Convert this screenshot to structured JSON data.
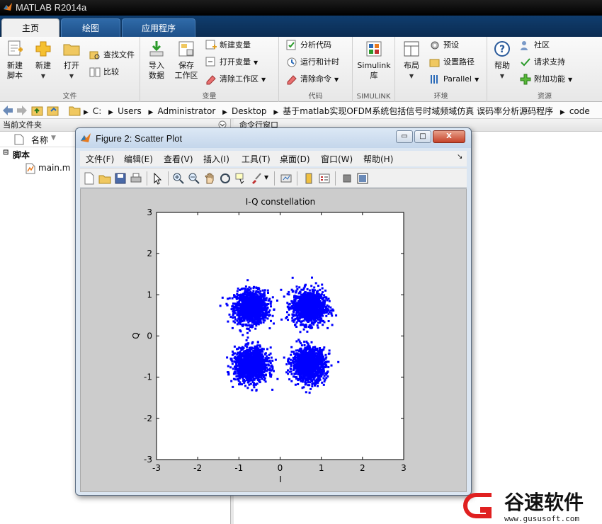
{
  "app": {
    "title": "MATLAB R2014a"
  },
  "tabs": [
    {
      "label": "主页",
      "active": true
    },
    {
      "label": "绘图",
      "active": false
    },
    {
      "label": "应用程序",
      "active": false
    }
  ],
  "ribbon": {
    "file": {
      "label": "文件",
      "new_script": "新建\n脚本",
      "new": "新建",
      "open": "打开",
      "find_files": "查找文件",
      "compare": "比较"
    },
    "variable": {
      "label": "变量",
      "import": "导入\n数据",
      "save_ws": "保存\n工作区",
      "new_var": "新建变量",
      "open_var": "打开变量",
      "clear_ws": "清除工作区"
    },
    "code": {
      "label": "代码",
      "analyze": "分析代码",
      "run_time": "运行和计时",
      "clear_cmds": "清除命令"
    },
    "simulink": {
      "label": "SIMULINK",
      "simulink": "Simulink\n库"
    },
    "env": {
      "label": "环境",
      "layout": "布局",
      "prefs": "预设",
      "set_path": "设置路径",
      "parallel": "Parallel"
    },
    "resources": {
      "label": "资源",
      "help": "帮助",
      "community": "社区",
      "support": "请求支持",
      "addons": "附加功能"
    }
  },
  "address": {
    "segments": [
      "C:",
      "Users",
      "Administrator",
      "Desktop",
      "基于matlab实现OFDM系统包括信号时域频域仿真 误码率分析源码程序",
      "code"
    ]
  },
  "current_folder": {
    "title": "当前文件夹",
    "col_name": "名称",
    "group": "脚本",
    "files": [
      "main.m"
    ]
  },
  "command_window": {
    "title": "命令行窗口"
  },
  "figure": {
    "title": "Figure 2: Scatter Plot",
    "menu": [
      "文件(F)",
      "编辑(E)",
      "查看(V)",
      "插入(I)",
      "工具(T)",
      "桌面(D)",
      "窗口(W)",
      "帮助(H)"
    ],
    "buttons": {
      "minimize": "▭",
      "maximize": "□",
      "close": "X"
    }
  },
  "chart_data": {
    "type": "scatter",
    "title": "I-Q constellation",
    "xlabel": "I",
    "ylabel": "Q",
    "xlim": [
      -3,
      3
    ],
    "ylim": [
      -3,
      3
    ],
    "xticks": [
      -3,
      -2,
      -1,
      0,
      1,
      2,
      3
    ],
    "yticks": [
      -3,
      -2,
      -1,
      0,
      1,
      2,
      3
    ],
    "grid": false,
    "marker": ".",
    "color": "#0000ff",
    "clusters": [
      {
        "x": -0.7,
        "y": 0.7
      },
      {
        "x": 0.7,
        "y": 0.7
      },
      {
        "x": -0.7,
        "y": -0.7
      },
      {
        "x": 0.7,
        "y": -0.7
      }
    ],
    "spread_std": 0.2,
    "points_per_cluster": 1200
  },
  "watermark": {
    "name": "谷速软件",
    "url": "www.gususoft.com",
    "accent": "#e02020"
  },
  "colors": {
    "accent": "#0b2c52",
    "plot_blue": "#0000ff"
  }
}
